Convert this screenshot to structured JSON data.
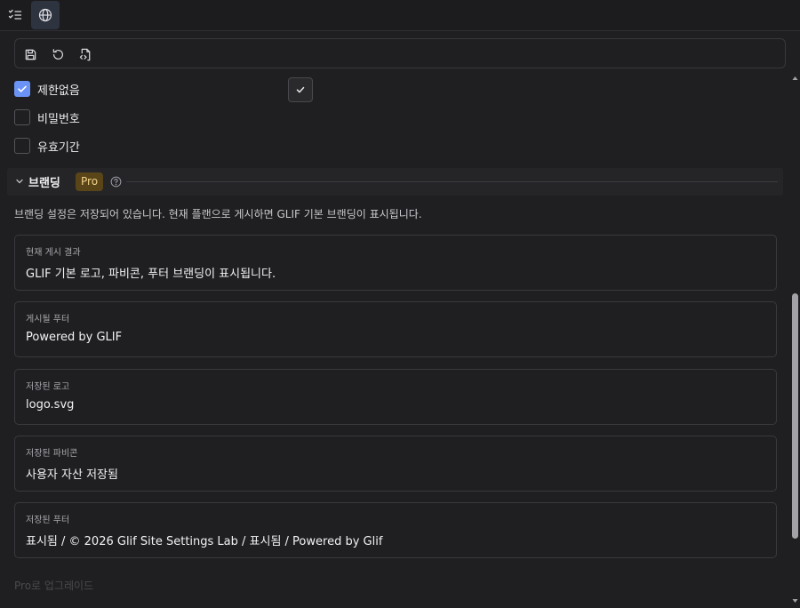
{
  "tabs": [
    {
      "icon": "checklist-icon",
      "active": false
    },
    {
      "icon": "globe-icon",
      "active": true
    }
  ],
  "toolbar": {
    "buttons": [
      {
        "icon": "save-icon"
      },
      {
        "icon": "refresh-icon"
      },
      {
        "icon": "file-code-icon"
      }
    ]
  },
  "options": {
    "no_limit": {
      "label": "제한없음",
      "checked": true
    },
    "password": {
      "label": "비밀번호",
      "checked": false
    },
    "expiry": {
      "label": "유효기간",
      "checked": false
    }
  },
  "branding": {
    "title": "브랜딩",
    "badge": "Pro",
    "description": "브랜딩 설정은 저장되어 있습니다. 현재 플랜으로 게시하면 GLIF 기본 브랜딩이 표시됩니다.",
    "cards": {
      "current": {
        "label": "현재 게시 결과",
        "value": "GLIF 기본 로고, 파비콘, 푸터 브랜딩이 표시됩니다."
      },
      "footer": {
        "label": "게시될 푸터",
        "value": "Powered by GLIF"
      },
      "logo": {
        "label": "저장된 로고",
        "value": "logo.svg"
      },
      "favicon": {
        "label": "저장된 파비콘",
        "value": "사용자 자산 저장됨"
      },
      "saved_footer": {
        "label": "저장된 푸터",
        "value": "표시됨 / © 2026 Glif Site Settings Lab / 표시됨 / Powered by Glif"
      }
    },
    "upgrade_label": "Pro로 업그레이드"
  },
  "colors": {
    "accent": "#6b93f5",
    "pro_badge_bg": "#5a4518",
    "pro_badge_text": "#f3d28a",
    "background": "#1f1f21"
  }
}
